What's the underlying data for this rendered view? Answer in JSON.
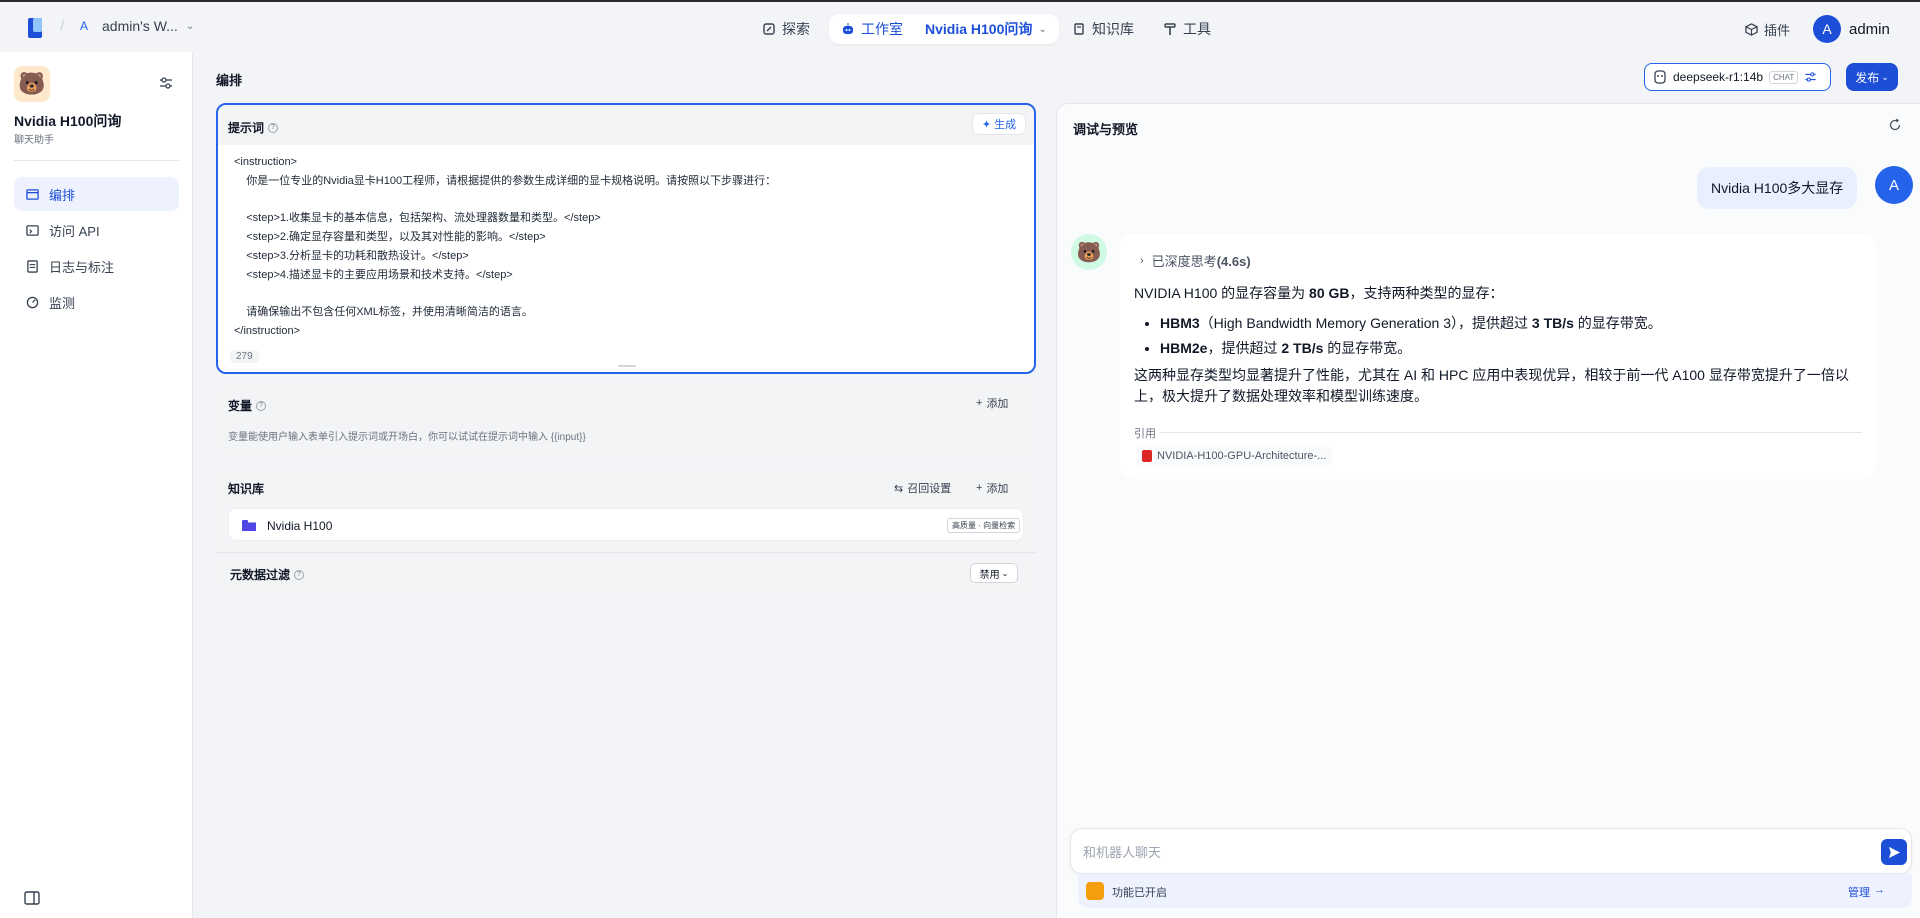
{
  "topbar": {
    "workspace_initial": "A",
    "workspace_name": "admin's W...",
    "nav_explore": "探索",
    "nav_studio": "工作室",
    "nav_app": "Nvidia H100问询",
    "nav_knowledge": "知识库",
    "nav_tools": "工具",
    "plugins": "插件",
    "user_initial": "A",
    "user_name": "admin"
  },
  "sidebar": {
    "app_name": "Nvidia H100问询",
    "app_type": "聊天助手",
    "items": [
      {
        "label": "编排",
        "icon": "layout-icon",
        "active": true
      },
      {
        "label": "访问 API",
        "icon": "terminal-icon",
        "active": false
      },
      {
        "label": "日志与标注",
        "icon": "log-icon",
        "active": false
      },
      {
        "label": "监测",
        "icon": "monitor-icon",
        "active": false
      }
    ]
  },
  "main": {
    "title": "编排",
    "model_name": "deepseek-r1:14b",
    "model_tag": "CHAT",
    "publish_label": "发布",
    "prompt": {
      "label": "提示词",
      "generate_label": "生成",
      "content": "<instruction>\n    你是一位专业的Nvidia显卡H100工程师，请根据提供的参数生成详细的显卡规格说明。请按照以下步骤进行：\n\n    <step>1.收集显卡的基本信息，包括架构、流处理器数量和类型。</step>\n    <step>2.确定显存容量和类型，以及其对性能的影响。</step>\n    <step>3.分析显卡的功耗和散热设计。</step>\n    <step>4.描述显卡的主要应用场景和技术支持。</step>\n\n    请确保输出不包含任何XML标签，并使用清晰简洁的语言。\n</instruction>",
      "char_count": "279"
    },
    "variables": {
      "label": "变量",
      "add_label": "添加",
      "description": "变量能使用户输入表单引入提示词或开场白，你可以试试在提示词中输入 {{input}}"
    },
    "knowledge": {
      "label": "知识库",
      "recall_label": "召回设置",
      "add_label": "添加",
      "item_name": "Nvidia H100",
      "item_tag": "高质量 · 向量检索",
      "metadata_label": "元数据过滤",
      "metadata_value": "禁用"
    }
  },
  "debug": {
    "title": "调试与预览",
    "user_message": "Nvidia H100多大显存",
    "user_initial": "A",
    "thinking_label": "已深度思考",
    "thinking_time": "(4.6s)",
    "answer": {
      "p1_a": "NVIDIA H100 的显存容量为 ",
      "p1_b": "80 GB",
      "p1_c": "，支持两种类型的显存：",
      "b1_a": "HBM3",
      "b1_b": "（High Bandwidth Memory Generation 3），提供超过 ",
      "b1_c": "3 TB/s",
      "b1_d": " 的显存带宽。",
      "b2_a": "HBM2e",
      "b2_b": "，提供超过 ",
      "b2_c": "2 TB/s",
      "b2_d": " 的显存带宽。",
      "p2": "这两种显存类型均显著提升了性能，尤其在 AI 和 HPC 应用中表现优异，相较于前一代 A100 显存带宽提升了一倍以上，极大提升了数据处理效率和模型训练速度。"
    },
    "citation_label": "引用",
    "citation_file": "NVIDIA-H100-GPU-Architecture-...",
    "input_placeholder": "和机器人聊天",
    "feature_text": "功能已开启",
    "manage_label": "管理"
  },
  "colors": {
    "accent": "#1d4ed8",
    "active_bg": "#eef2ff",
    "page_bg": "#f2f4f7"
  }
}
